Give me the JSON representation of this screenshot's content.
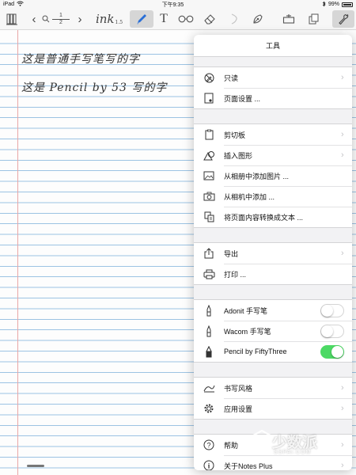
{
  "status_bar": {
    "device": "iPad",
    "time": "下午9:35",
    "battery": "99%"
  },
  "toolbar": {
    "page_current": "1",
    "page_total": "2",
    "ink_label": "ink",
    "ink_size": "1.5",
    "text_tool": "T"
  },
  "notes": {
    "line1": "这是普通手写笔写的字",
    "line2": "这是 Pencil by 53 写的字"
  },
  "tools_menu": {
    "title": "工具",
    "groups": [
      [
        {
          "icon": "read-only-icon",
          "label": "只读",
          "chevron": true
        },
        {
          "icon": "page-settings-icon",
          "label": "页面设置 ...",
          "chevron": false
        }
      ],
      [
        {
          "icon": "clipboard-icon",
          "label": "剪切板",
          "chevron": true
        },
        {
          "icon": "shapes-icon",
          "label": "插入图形",
          "chevron": true
        },
        {
          "icon": "photo-icon",
          "label": "从相册中添加图片 ...",
          "chevron": false
        },
        {
          "icon": "camera-icon",
          "label": "从相机中添加 ...",
          "chevron": false
        },
        {
          "icon": "convert-text-icon",
          "label": "将页面内容转换成文本 ...",
          "chevron": false
        }
      ],
      [
        {
          "icon": "export-icon",
          "label": "导出",
          "chevron": true
        },
        {
          "icon": "print-icon",
          "label": "打印 ...",
          "chevron": false
        }
      ],
      [
        {
          "icon": "stylus-icon",
          "label": "Adonit 手写笔",
          "toggle": false
        },
        {
          "icon": "stylus-icon",
          "label": "Wacom 手写笔",
          "toggle": false
        },
        {
          "icon": "pencil-stylus-icon",
          "label": "Pencil by FiftyThree",
          "toggle": true
        }
      ],
      [
        {
          "icon": "writing-style-icon",
          "label": "书写风格",
          "chevron": true
        },
        {
          "icon": "gear-icon",
          "label": "应用设置",
          "chevron": true
        }
      ],
      [
        {
          "icon": "help-icon",
          "label": "帮助",
          "chevron": true
        },
        {
          "icon": "info-icon",
          "label": "关于Notes Plus",
          "chevron": true
        }
      ]
    ]
  },
  "watermark": {
    "main": "少数派",
    "sub": "SSPAI.COM"
  },
  "colors": {
    "toggle_on": "#4cd964",
    "ruled_line": "#9cc3e3",
    "margin_line": "#e9a7a7",
    "pen_active": "#2a6fd6"
  }
}
